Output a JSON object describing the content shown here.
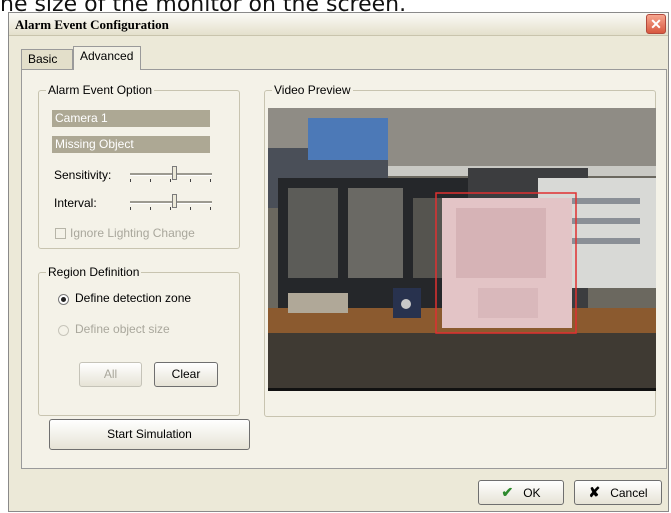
{
  "caption": "he size of the monitor on the screen.",
  "window": {
    "title": "Alarm Event Configuration",
    "close_icon": "close-icon",
    "close_glyph": "✕"
  },
  "tabs": [
    {
      "label": "Basic",
      "active": false
    },
    {
      "label": "Advanced",
      "active": true
    }
  ],
  "alarm_event_option": {
    "legend": "Alarm Event Option",
    "camera": "Camera 1",
    "event": "Missing Object",
    "sensitivity_label": "Sensitivity:",
    "sensitivity_level": 0.55,
    "interval_label": "Interval:",
    "interval_level": 0.55,
    "ignore_lighting_label": "Ignore Lighting Change",
    "ignore_lighting_checked": false
  },
  "region_definition": {
    "legend": "Region Definition",
    "detection_zone_label": "Define detection zone",
    "detection_zone_selected": true,
    "object_size_label": "Define object size",
    "object_size_selected": false,
    "all_label": "All",
    "clear_label": "Clear"
  },
  "video_preview": {
    "legend": "Video Preview"
  },
  "start_simulation_label": "Start Simulation",
  "ok_label": "OK",
  "ok_icon": "check-icon",
  "ok_glyph": "✔",
  "cancel_label": "Cancel",
  "cancel_icon": "x-icon",
  "cancel_glyph": "✘",
  "colors": {
    "dialog": "#ece9d8",
    "readonly_field": "#ada894",
    "zone_highlight": "#e03030"
  }
}
